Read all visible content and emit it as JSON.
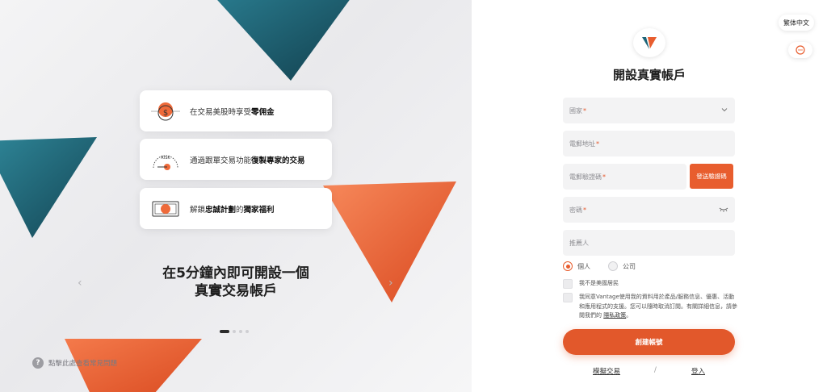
{
  "hero": {
    "features": [
      {
        "icon": "dollar-coin-icon",
        "text_prefix": "在交易美股時享受",
        "text_bold": "零佣金",
        "text_suffix": ""
      },
      {
        "icon": "risk-gauge-icon",
        "text_prefix": "通過跟單交易功能",
        "text_bold": "復製專家的交易",
        "text_suffix": ""
      },
      {
        "icon": "gift-card-icon",
        "text_prefix": "解鎖",
        "text_bold": "忠誠計劃",
        "text_mid": "的",
        "text_bold2": "獨家福利"
      }
    ],
    "risk_label": "RISK",
    "title_line1": "在5分鐘內即可開設一個",
    "title_line2": "真實交易帳戶",
    "prev_arrow": "‹",
    "next_arrow": "›",
    "faq_icon": "?",
    "faq_text": "點擊此處查看常見問題",
    "colors": {
      "teal": "#1d6478",
      "orange": "#ee6a3a"
    }
  },
  "form": {
    "language": "繁体中文",
    "title": "開設真實帳戶",
    "country_placeholder": "國家",
    "email_placeholder": "電郵地址",
    "code_placeholder": "電郵驗證碼",
    "send_code_label": "發送驗證碼",
    "password_placeholder": "密碼",
    "referrer_placeholder": "推薦人",
    "required_mark": "*",
    "account_type_personal": "個人",
    "account_type_company": "公司",
    "not_us_resident": "我不是美國居民",
    "consent_text": "我同意Vantage使用我的資料用於產品/服務信息、優惠、活動和應用程式的支援。您可以隨時取消訂閱。有關詳細信息，請參閱我們的",
    "privacy_link": "隱私政策",
    "consent_end": "。",
    "submit_label": "創建帳號",
    "demo_link": "模擬交易",
    "separator": "/",
    "login_link": "登入",
    "colors": {
      "accent": "#e85d2e"
    }
  }
}
